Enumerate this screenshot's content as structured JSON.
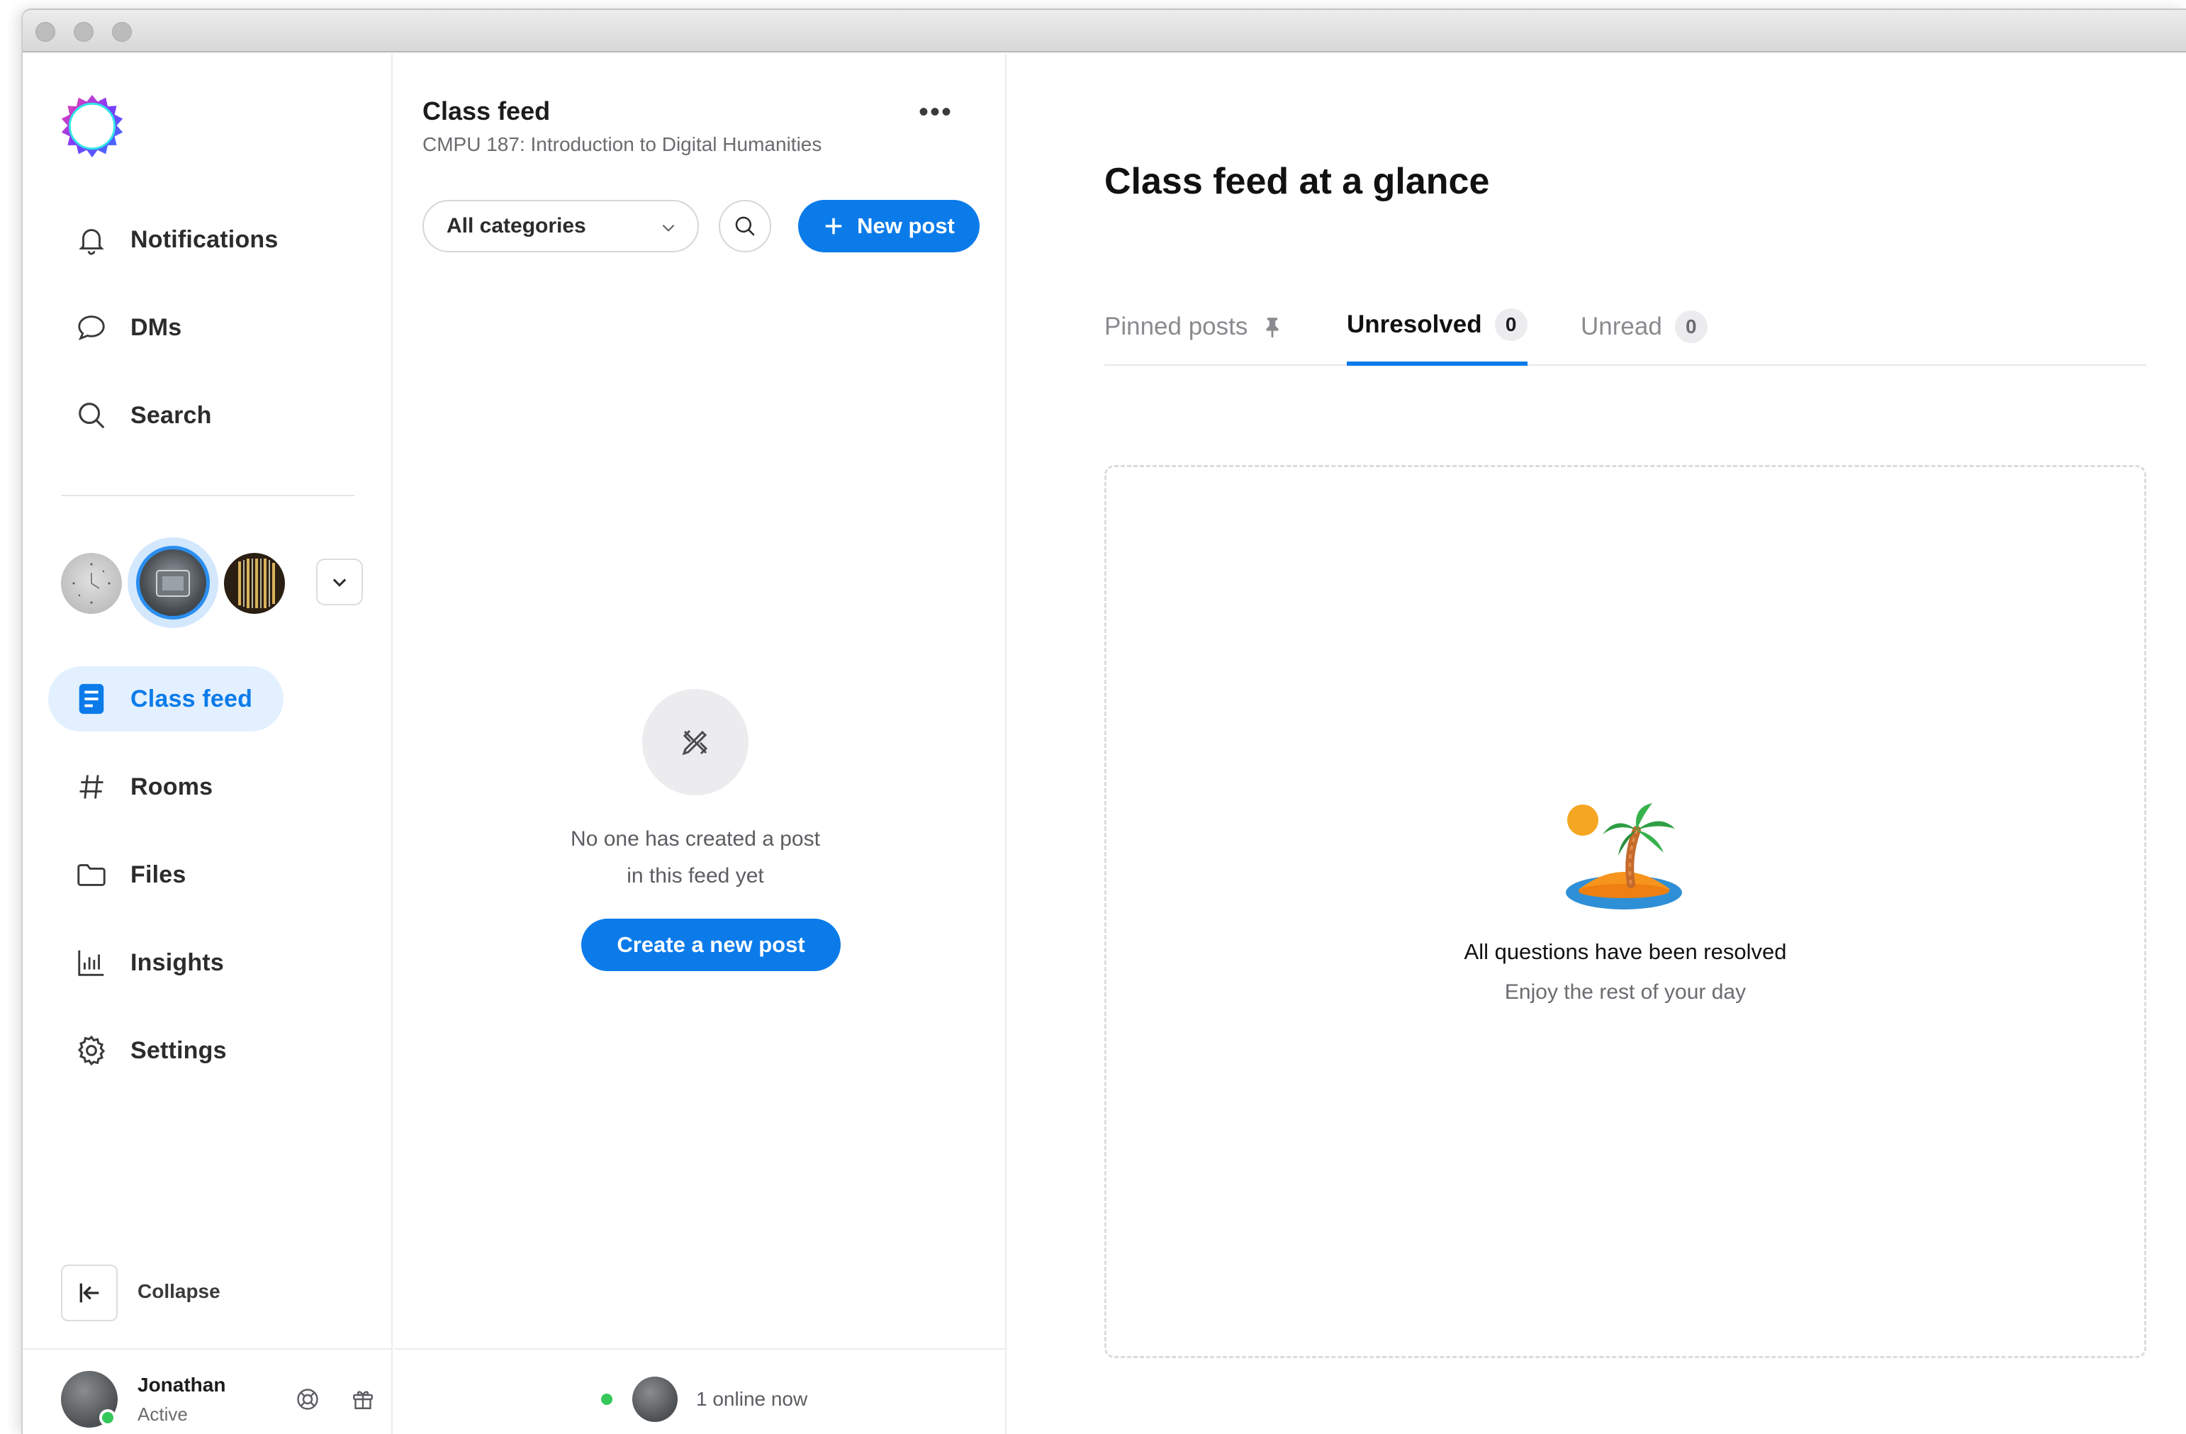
{
  "sidebar": {
    "nav_top": [
      {
        "label": "Notifications",
        "icon": "bell-icon"
      },
      {
        "label": "DMs",
        "icon": "chat-bubble-icon"
      },
      {
        "label": "Search",
        "icon": "search-icon"
      }
    ],
    "nav_main": [
      {
        "label": "Class feed",
        "icon": "document-icon",
        "active": true
      },
      {
        "label": "Rooms",
        "icon": "hash-icon"
      },
      {
        "label": "Files",
        "icon": "folder-icon"
      },
      {
        "label": "Insights",
        "icon": "bar-chart-icon"
      },
      {
        "label": "Settings",
        "icon": "gear-icon"
      }
    ],
    "collapse_label": "Collapse",
    "user": {
      "name": "Jonathan",
      "status": "Active"
    }
  },
  "feed": {
    "title": "Class feed",
    "subtitle": "CMPU 187: Introduction to Digital Humanities",
    "category_select": "All categories",
    "new_post_label": "New post",
    "empty_line1": "No one has created a post",
    "empty_line2": "in this feed yet",
    "create_button": "Create a new post",
    "online_text": "1 online now"
  },
  "main": {
    "title": "Class feed at a glance",
    "tabs": [
      {
        "label": "Pinned posts",
        "icon": "pin-icon"
      },
      {
        "label": "Unresolved",
        "count": "0",
        "active": true
      },
      {
        "label": "Unread",
        "count": "0"
      }
    ],
    "empty_title": "All questions have been resolved",
    "empty_subtitle": "Enjoy the rest of your day"
  },
  "colors": {
    "accent": "#0b7bea",
    "active_bg": "#e3f0ff",
    "online": "#34c759"
  }
}
